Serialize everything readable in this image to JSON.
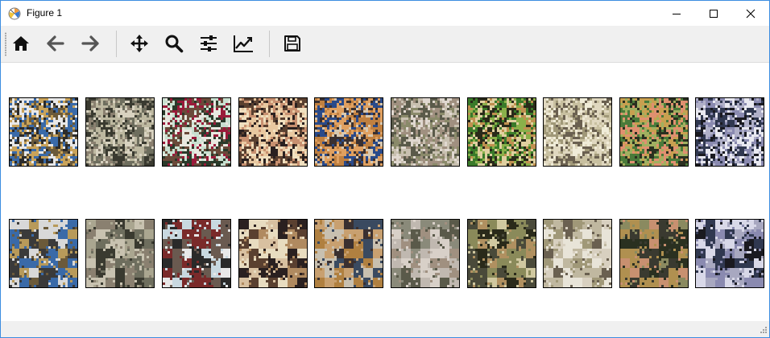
{
  "window": {
    "title": "Figure 1"
  },
  "toolbar": {
    "buttons": [
      {
        "icon": "home-icon"
      },
      {
        "icon": "back-arrow-icon"
      },
      {
        "icon": "forward-arrow-icon"
      },
      {
        "icon": "pan-move-icon"
      },
      {
        "icon": "zoom-magnifier-icon"
      },
      {
        "icon": "configure-subplots-icon"
      },
      {
        "icon": "edit-axis-curve-icon"
      },
      {
        "icon": "save-floppy-icon"
      }
    ]
  },
  "figure": {
    "rows": [
      {
        "label_role": "noisy-input-images",
        "images": [
          {
            "palette": [
              "#3a6aa8",
              "#c9a35a",
              "#e8e8e8",
              "#6b5a3a",
              "#2b2b2b"
            ],
            "noise": 0.55
          },
          {
            "palette": [
              "#6e6e5e",
              "#3a3a30",
              "#bdb8a0",
              "#8a8070",
              "#d8d2c0"
            ],
            "noise": 0.55
          },
          {
            "palette": [
              "#9a1a3a",
              "#2a3a2a",
              "#c8e0d0",
              "#e8e8e0",
              "#6a4a3a"
            ],
            "noise": 0.55
          },
          {
            "palette": [
              "#c89070",
              "#2a2020",
              "#e8c8a0",
              "#5a4030",
              "#f0e0c0"
            ],
            "noise": 0.55
          },
          {
            "palette": [
              "#2a4a8a",
              "#c08040",
              "#e0a060",
              "#3a3030",
              "#d8c8b0"
            ],
            "noise": 0.55
          },
          {
            "palette": [
              "#8a8a6a",
              "#c8c0b0",
              "#5a5a4a",
              "#e0d8d0",
              "#a09080"
            ],
            "noise": 0.55
          },
          {
            "palette": [
              "#3a7a2a",
              "#8ab04a",
              "#2a2a1a",
              "#c09050",
              "#e0d0a0"
            ],
            "noise": 0.55
          },
          {
            "palette": [
              "#c8c0a0",
              "#e0d8c0",
              "#6a6050",
              "#a09878",
              "#f0ecd8"
            ],
            "noise": 0.55
          },
          {
            "palette": [
              "#4a7a3a",
              "#c8a050",
              "#e09070",
              "#2a3020",
              "#a0b060"
            ],
            "noise": 0.55
          },
          {
            "palette": [
              "#303850",
              "#e8e8f0",
              "#8a8ab0",
              "#b0b0c8",
              "#1a1a20"
            ],
            "noise": 0.55
          }
        ]
      },
      {
        "label_role": "denoised-output-images",
        "images": [
          {
            "palette": [
              "#3a6aa8",
              "#b89a5a",
              "#d8d8d8",
              "#6b5a3a",
              "#3a3a3a"
            ],
            "noise": 0.18
          },
          {
            "palette": [
              "#6e6e5e",
              "#3a3a30",
              "#aaa690",
              "#8a8070",
              "#c8c2b0"
            ],
            "noise": 0.18
          },
          {
            "palette": [
              "#7a2a2a",
              "#2a2a2a",
              "#c8d8e0",
              "#e8e8e8",
              "#6a5a50"
            ],
            "noise": 0.18
          },
          {
            "palette": [
              "#b08a60",
              "#2a2020",
              "#d8c0a0",
              "#5a4030",
              "#e8dcc0"
            ],
            "noise": 0.18
          },
          {
            "palette": [
              "#3a4a60",
              "#b08040",
              "#c8a070",
              "#3a3030",
              "#c8c0b0"
            ],
            "noise": 0.18
          },
          {
            "palette": [
              "#8a8a7a",
              "#c0b8b0",
              "#5a5a4a",
              "#d8d0c8",
              "#a09080"
            ],
            "noise": 0.18
          },
          {
            "palette": [
              "#4a4a3a",
              "#8a8a5a",
              "#2a2a1a",
              "#b09060",
              "#d0c8a0"
            ],
            "noise": 0.18
          },
          {
            "palette": [
              "#c0b8a0",
              "#d8d0c0",
              "#6a6050",
              "#a09878",
              "#e8e4d8"
            ],
            "noise": 0.18
          },
          {
            "palette": [
              "#3a3a30",
              "#b09050",
              "#c89070",
              "#2a3020",
              "#8a8a60"
            ],
            "noise": 0.18
          },
          {
            "palette": [
              "#303850",
              "#d8d8e8",
              "#8a8ab0",
              "#a8a8c0",
              "#1a1a20"
            ],
            "noise": 0.18
          }
        ]
      }
    ]
  }
}
